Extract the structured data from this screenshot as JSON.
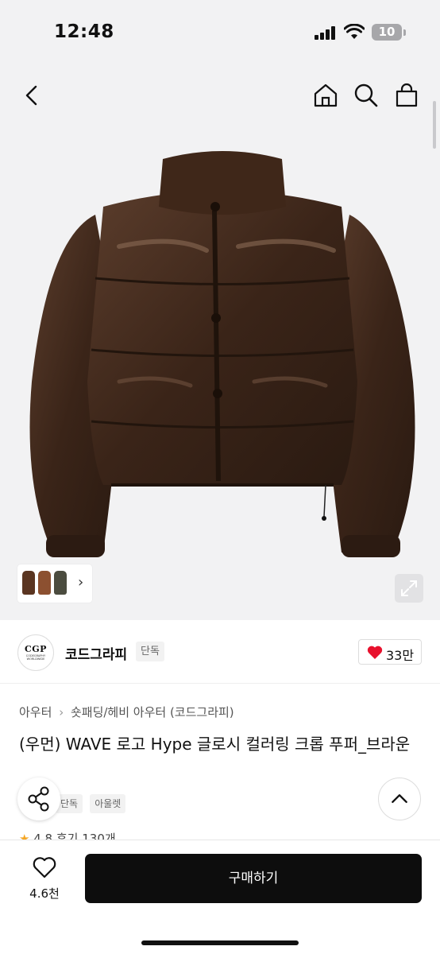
{
  "status_bar": {
    "time": "12:48",
    "battery": "10"
  },
  "nav": {
    "icons": [
      "back-icon",
      "home-icon",
      "search-icon",
      "shopping-bag-icon"
    ]
  },
  "gallery": {
    "thumb_colors": [
      "#5a3521",
      "#8c5030",
      "#4b4c3f"
    ]
  },
  "brand": {
    "logo_text": "CGP",
    "logo_subtext": "CODEGRAPHY WORLDWIDE",
    "name": "코드그라피",
    "exclusive_label": "단독",
    "likes": "33만"
  },
  "breadcrumb": {
    "category": "아우터",
    "separator": "›",
    "subcategory": "숏패딩/헤비 아우터 (코드그라피)"
  },
  "product": {
    "title": "(우먼) WAVE 로고 Hype 글로시 컬러링 크롭 푸퍼_브라운",
    "tags": [
      "단독",
      "아울렛"
    ],
    "rating_star": "★",
    "rating": "4.8",
    "reviews": "후기 130개"
  },
  "bottom_bar": {
    "wish_count": "4.6천",
    "buy_label": "구매하기"
  },
  "colors": {
    "buy_button": "#0d0d0d",
    "heart": "#e8112d",
    "star": "#f5a623",
    "jacket": "#3a2418"
  }
}
